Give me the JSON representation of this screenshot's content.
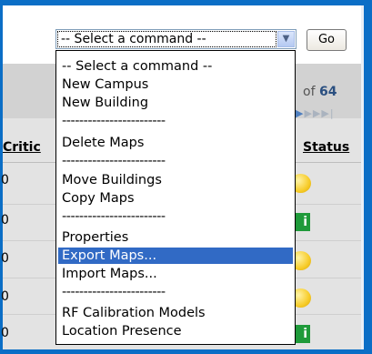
{
  "command_select": {
    "value": "-- Select a command --",
    "options": [
      "-- Select a command --",
      "New Campus",
      "New Building",
      "------------------------",
      "Delete Maps",
      "------------------------",
      "Move Buildings",
      "Copy Maps",
      "------------------------",
      "Properties",
      "Export Maps...",
      "Import Maps...",
      "------------------------",
      "RF Calibration Models",
      "Location Presence"
    ],
    "highlighted": "Export Maps..."
  },
  "go_button": {
    "label": "Go"
  },
  "pager": {
    "of_text": "of",
    "total": "64"
  },
  "table": {
    "headers": {
      "critical": "Critic",
      "status": "Status"
    },
    "row_values": [
      "0",
      "0",
      "0",
      "0",
      "0"
    ]
  },
  "colors": {
    "frame": "#0b6ec6",
    "highlight": "#316ac5",
    "status_yellow": "#f7cc2a",
    "status_green": "#1f9a3a"
  },
  "icons": {
    "dropdown_arrow": "chevron-down-icon",
    "pager": "pager-arrow-icons",
    "status_ok": "info-icon",
    "status_minor": "yellow-dot-icon"
  }
}
